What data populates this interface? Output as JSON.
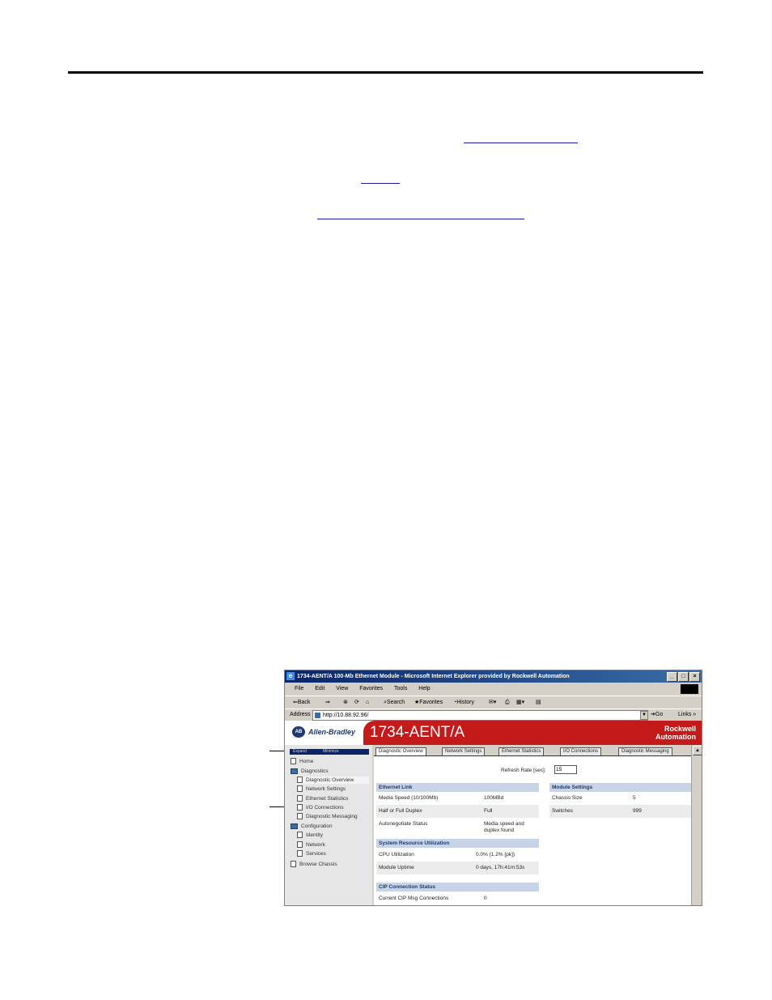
{
  "window": {
    "title": "1734-AENT/A 100-Mb Ethernet Module - Microsoft Internet Explorer provided by Rockwell Automation",
    "minimize": "_",
    "maximize": "□",
    "close": "×"
  },
  "menu": [
    "File",
    "Edit",
    "View",
    "Favorites",
    "Tools",
    "Help"
  ],
  "toolbar": {
    "back": "⇐Back",
    "forward": "⇒",
    "search": "Search",
    "favorites": "Favorites",
    "history": "History"
  },
  "address": {
    "label": "Address",
    "url": "http://10.88.92.96/",
    "go": "Go",
    "links": "Links »"
  },
  "header": {
    "brand_logo": "AB",
    "brand": "Allen-Bradley",
    "product": "1734-AENT/A",
    "corp_line1": "Rockwell",
    "corp_line2": "Automation"
  },
  "nav": {
    "expand": "Expand",
    "minimize": "Minimize",
    "items": [
      {
        "label": "Home"
      },
      {
        "label": "Diagnostics"
      },
      {
        "label": "Diagnostic Overview"
      },
      {
        "label": "Network Settings"
      },
      {
        "label": "Ethernet Statistics"
      },
      {
        "label": "I/O Connections"
      },
      {
        "label": "Diagnostic Messaging"
      },
      {
        "label": "Configuration"
      },
      {
        "label": "Identity"
      },
      {
        "label": "Network"
      },
      {
        "label": "Services"
      },
      {
        "label": "Browse Chassis"
      }
    ]
  },
  "tabs": [
    {
      "label": "Diagnostic Overview"
    },
    {
      "label": "Network Settings"
    },
    {
      "label": "Ethernet Statistics"
    },
    {
      "label": "I/O Connections"
    },
    {
      "label": "Diagnostic Messaging"
    }
  ],
  "refresh": {
    "label": "Refresh Rate [sec]:",
    "value": "15"
  },
  "ethernet_link": {
    "title": "Ethernet Link",
    "rows": [
      {
        "label": "Media Speed (10/100Mb)",
        "value": "100MBd"
      },
      {
        "label": "Half or Full Duplex",
        "value": "Full"
      },
      {
        "label": "Autonegotiate Status",
        "value": "Media speed and",
        "value2": "duplex found"
      }
    ]
  },
  "module_settings": {
    "title": "Module Settings",
    "rows": [
      {
        "label": "Chassis Size",
        "value": "5"
      },
      {
        "label": "Switches",
        "value": "999"
      }
    ]
  },
  "system_resource": {
    "title": "System Resource Utilization",
    "rows": [
      {
        "label": "CPU Utilization",
        "value": "0.0%  (1.2% [pk])"
      },
      {
        "label": "Module Uptime",
        "value": "0 days, 17h:41m:53s"
      }
    ]
  },
  "cip": {
    "title": "CIP Connection Status",
    "rows": [
      {
        "label": "Current CIP Msg Connections",
        "value": "0"
      }
    ]
  }
}
